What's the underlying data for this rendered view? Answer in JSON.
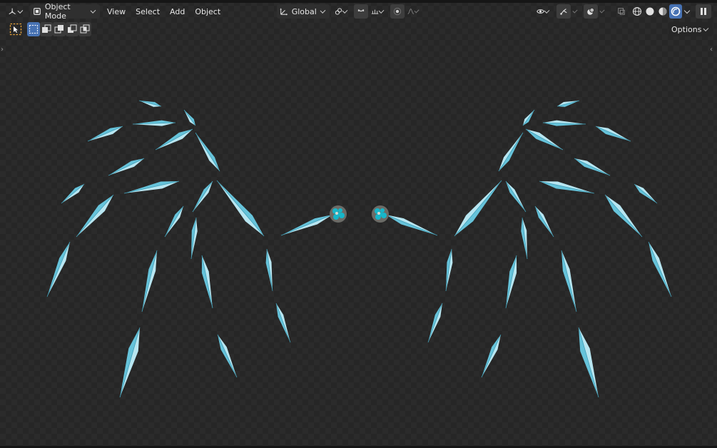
{
  "header": {
    "editor_type_icon": "view3d-icon",
    "mode_label": "Object Mode",
    "menus": [
      "View",
      "Select",
      "Add",
      "Object"
    ],
    "transform_orientation": "Global",
    "options_label": "Options"
  },
  "icons": {
    "select_tool": "select-box-icon",
    "pivot": "transform-pivot-icon",
    "snap": "snap-icon",
    "proportional": "proportional-edit-icon",
    "visibility": "visibility-eye-icon",
    "gizmo": "gizmo-icon",
    "overlay": "overlay-icon",
    "xray": "xray-icon",
    "pause": "pause-icon"
  },
  "colors": {
    "accent": "#4772b3",
    "crystal_base": "#66c3da",
    "crystal_light": "#b8e6f1",
    "crystal_dark": "#3f9fb8",
    "background": "#2b2b2b"
  }
}
